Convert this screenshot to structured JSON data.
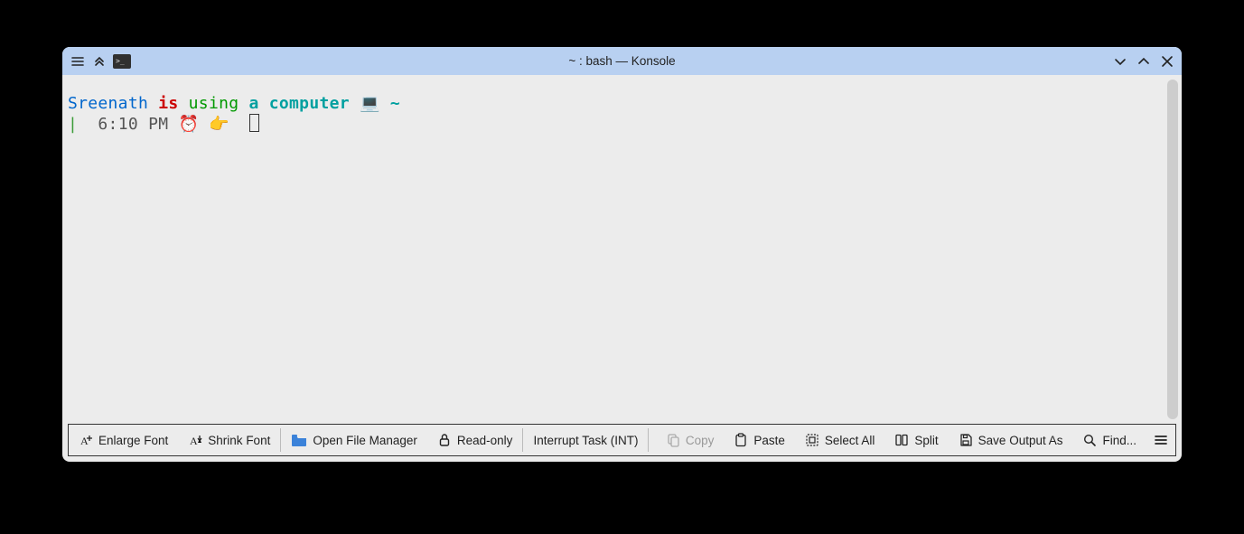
{
  "window": {
    "title": "~ : bash — Konsole"
  },
  "prompt": {
    "user": "Sreenath",
    "is": "is",
    "using": "using",
    "a_computer": " a computer ",
    "laptop_emoji": "💻",
    "tilde": " ~",
    "pipe": "| ",
    "time": " 6:10 PM ",
    "clock_emoji": "⏰",
    "hand_emoji": " 👉 "
  },
  "toolbar": {
    "enlarge_font": "Enlarge Font",
    "shrink_font": "Shrink Font",
    "open_file_manager": "Open File Manager",
    "read_only": "Read-only",
    "interrupt": "Interrupt Task (INT)",
    "copy": "Copy",
    "paste": "Paste",
    "select_all": "Select All",
    "split": "Split",
    "save_output": "Save Output As",
    "find": "Find..."
  }
}
